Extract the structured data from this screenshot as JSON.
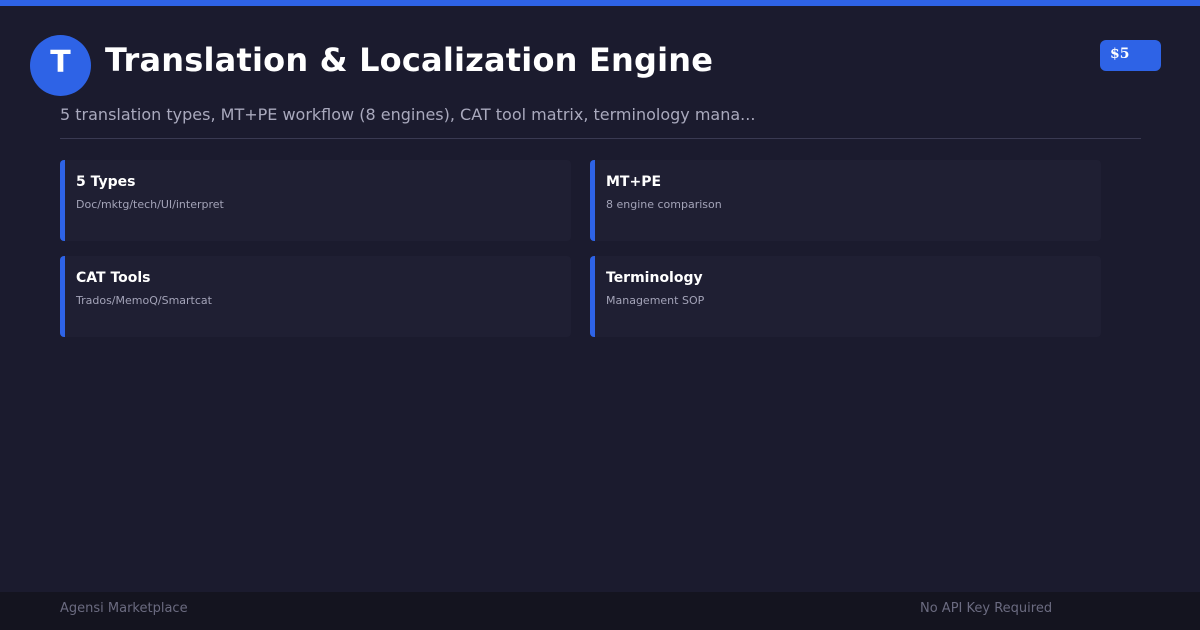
{
  "header": {
    "avatar_letter": "T",
    "title": "Translation & Localization Engine",
    "price": "$5",
    "subtitle": "5 translation types, MT+PE workflow (8 engines), CAT tool matrix, terminology mana..."
  },
  "features": [
    {
      "title": "5 Types",
      "description": "Doc/mktg/tech/UI/interpret"
    },
    {
      "title": "MT+PE",
      "description": "8 engine comparison"
    },
    {
      "title": "CAT Tools",
      "description": "Trados/MemoQ/Smartcat"
    },
    {
      "title": "Terminology",
      "description": "Management SOP"
    }
  ],
  "footer": {
    "brand": "Agensi Marketplace",
    "note": "No API Key Required"
  },
  "colors": {
    "accent": "#2e63e6",
    "background": "#1b1b2e",
    "card": "#1f1f33",
    "footer": "#14141f"
  }
}
